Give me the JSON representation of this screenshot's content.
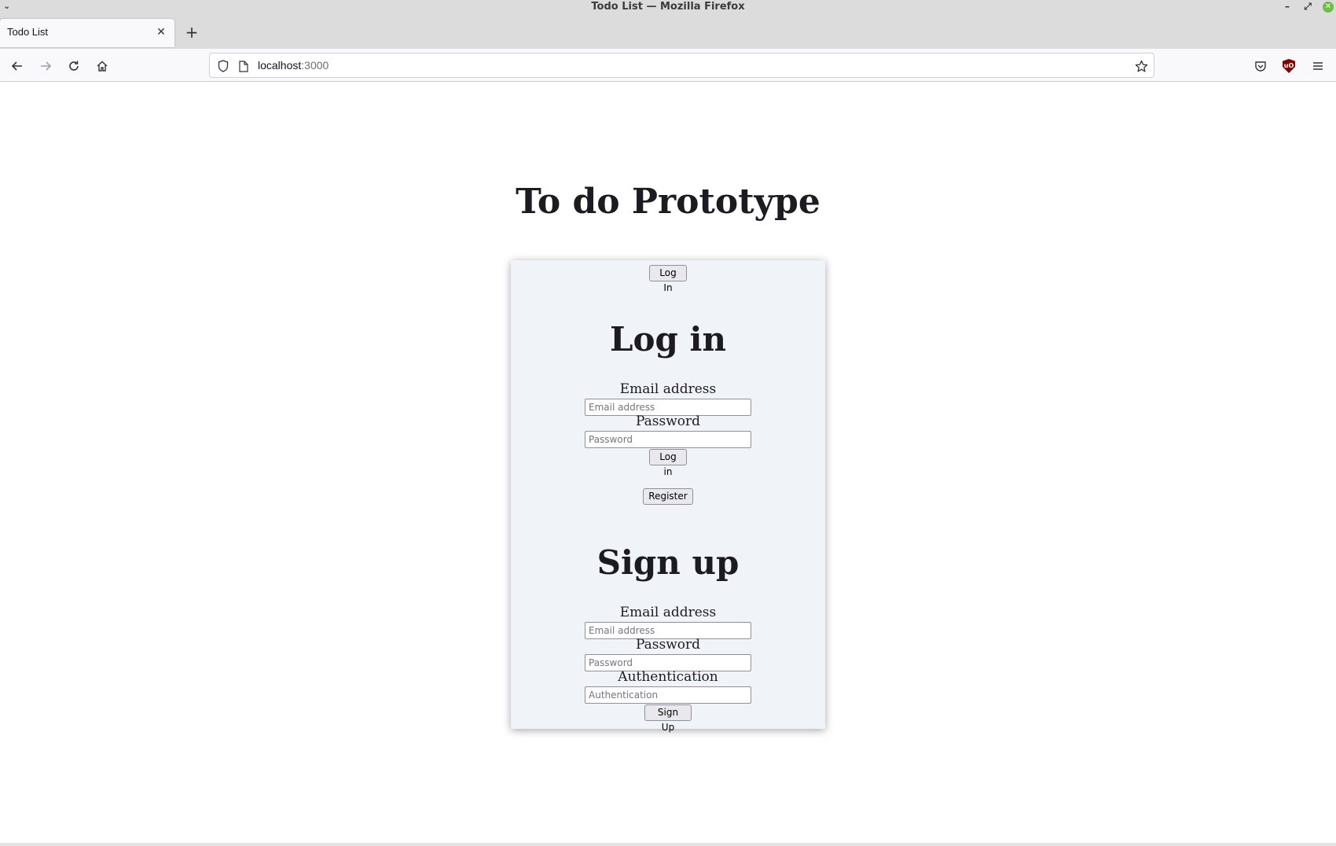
{
  "window": {
    "title": "Todo List — Mozilla Firefox",
    "menu_glyph": "⌄",
    "minimize_glyph": "–",
    "restore_glyph": "⤢",
    "close_glyph": "✕"
  },
  "tabs": [
    {
      "label": "Todo List",
      "active": true,
      "close_glyph": "✕"
    }
  ],
  "newtab_glyph": "+",
  "navbar": {
    "url_host": "localhost",
    "url_port": ":3000",
    "icons": [
      "back-icon",
      "forward-icon",
      "reload-icon",
      "home-icon",
      "shield-icon",
      "page-icon",
      "bookmark-star-icon",
      "pocket-icon",
      "ublock-icon",
      "menu-icon"
    ],
    "ublock_text": "uO"
  },
  "page": {
    "title": "To do Prototype",
    "toggle_button": "Log In",
    "login": {
      "heading": "Log in",
      "email_label": "Email address",
      "email_placeholder": "Email address",
      "password_label": "Password",
      "password_placeholder": "Password",
      "submit": "Log in",
      "register": "Register"
    },
    "signup": {
      "heading": "Sign up",
      "email_label": "Email address",
      "email_placeholder": "Email address",
      "password_label": "Password",
      "password_placeholder": "Password",
      "auth_label": "Authentication",
      "auth_placeholder": "Authentication",
      "submit": "Sign Up"
    }
  },
  "colors": {
    "chrome_bg": "#dcdcdc",
    "toolbar_bg": "#f9f9fb",
    "card_bg": "#f0f4f8",
    "ublock_red": "#800000",
    "close_green": "#6cbf43"
  }
}
